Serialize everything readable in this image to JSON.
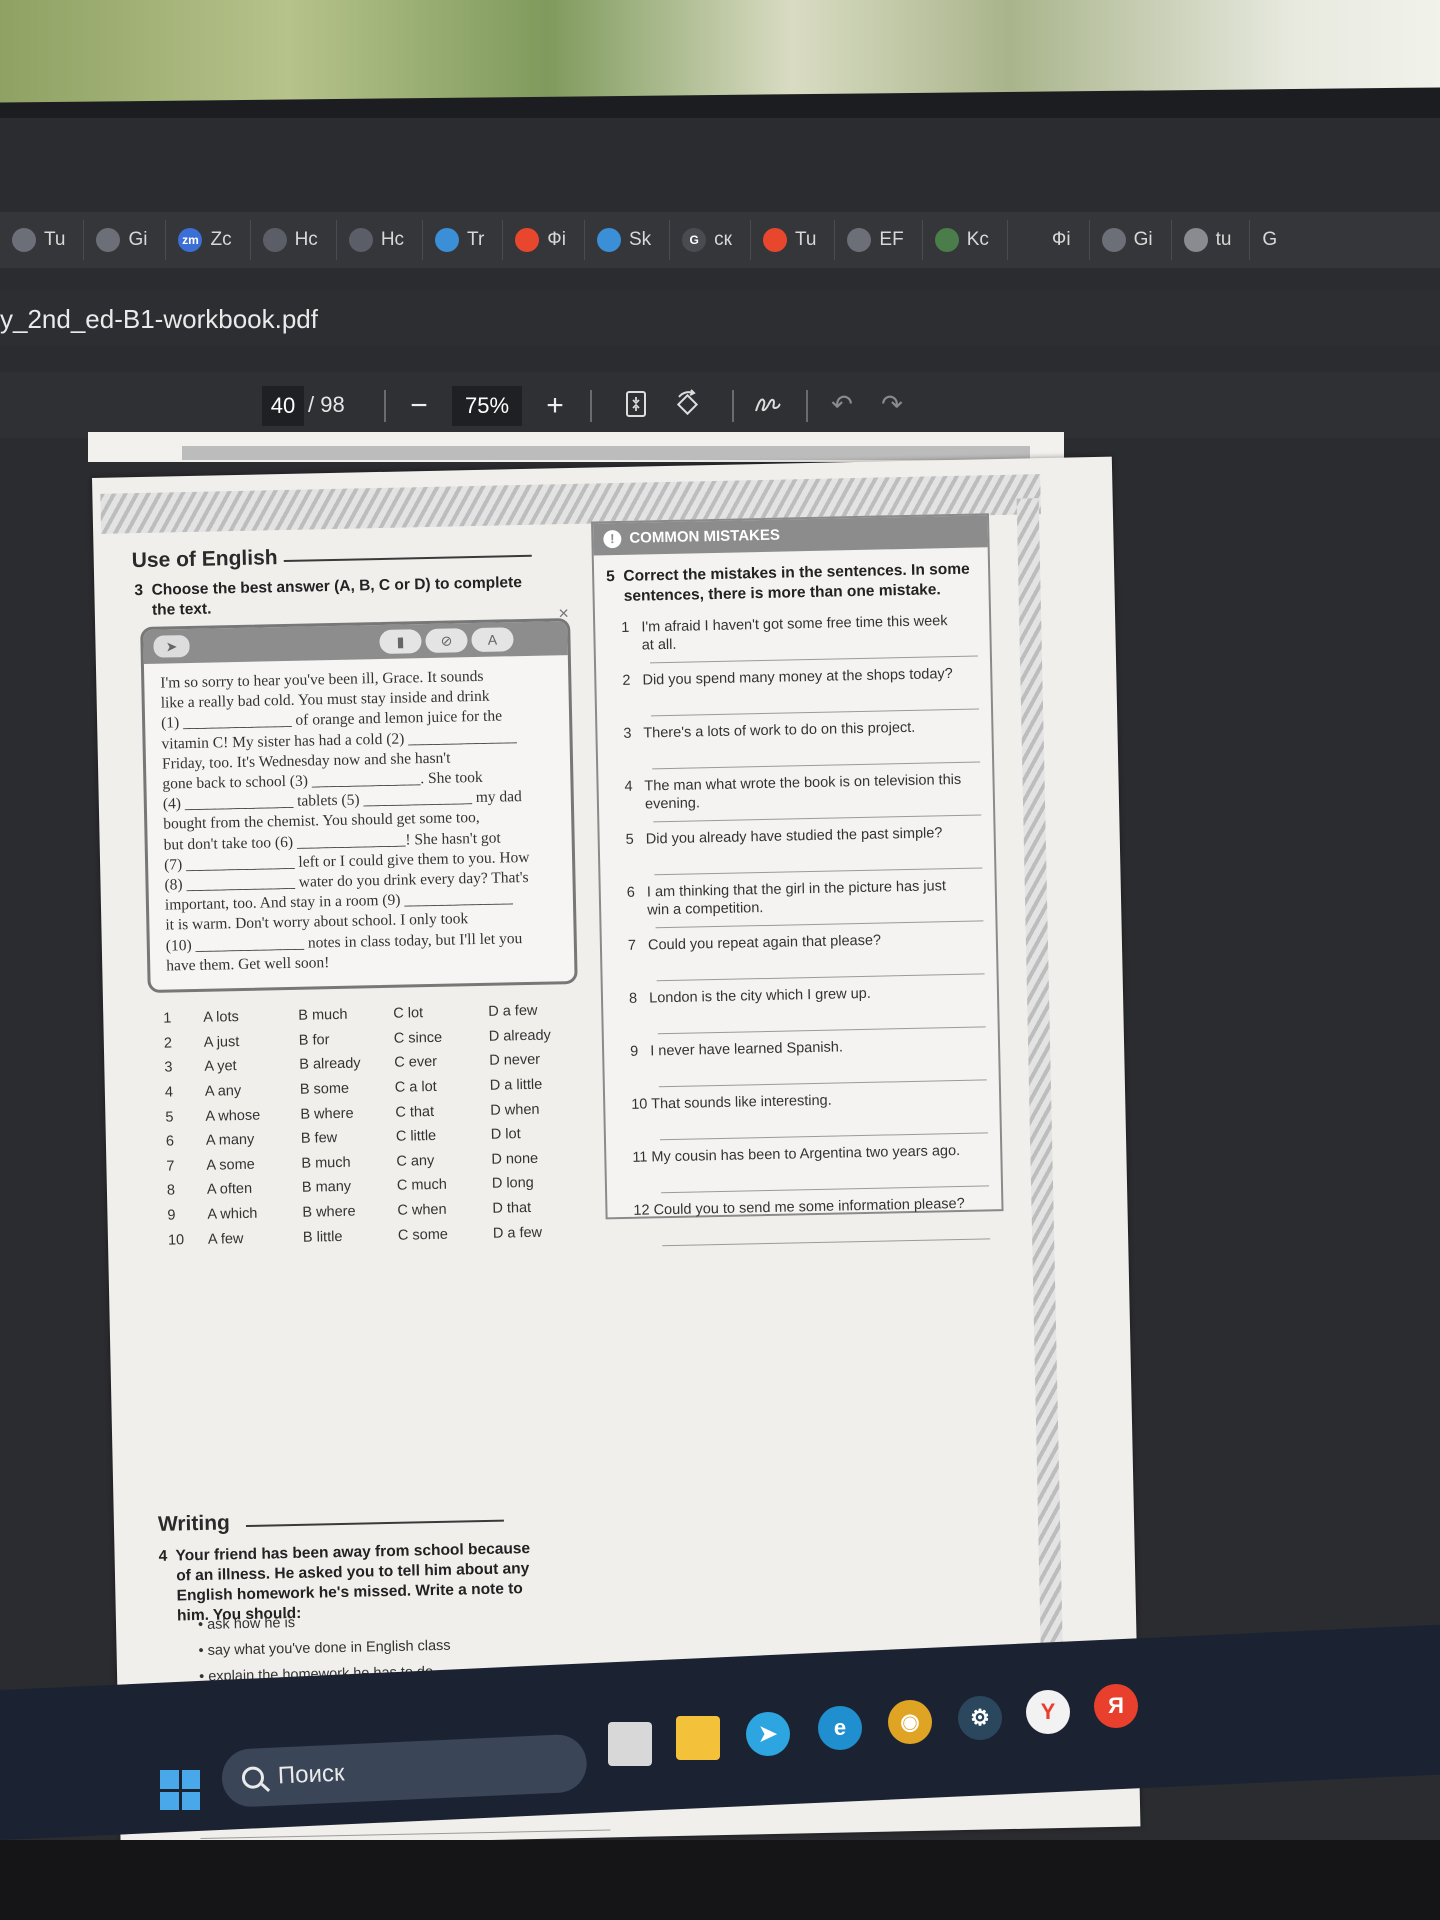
{
  "bookmarks": [
    {
      "label": "Tu",
      "icon": "steam-icon",
      "color": "#6c6f78"
    },
    {
      "label": "Gi",
      "icon": "steam-icon",
      "color": "#6c6f78"
    },
    {
      "label": "Zc",
      "icon": "zm-icon",
      "color": "#3b6fd6"
    },
    {
      "label": "Hc",
      "icon": "shield-icon",
      "color": "#5b5e66"
    },
    {
      "label": "Hc",
      "icon": "shield-icon",
      "color": "#5b5e66"
    },
    {
      "label": "Tr",
      "icon": "cube-icon",
      "color": "#3b8fd6"
    },
    {
      "label": "Фi",
      "icon": "reddit-icon",
      "color": "#e8472d"
    },
    {
      "label": "Sk",
      "icon": "cube-icon",
      "color": "#3b8fd6"
    },
    {
      "label": "ск",
      "icon": "google-icon",
      "color": "#4a4b50"
    },
    {
      "label": "Tu",
      "icon": "flower-icon",
      "color": "#e8472d"
    },
    {
      "label": "EF",
      "icon": "steam-icon",
      "color": "#6c6f78"
    },
    {
      "label": "Kc",
      "icon": "globe-icon",
      "color": "#4b7d4a"
    },
    {
      "label": "Фi",
      "icon": "",
      "color": "#35363a"
    },
    {
      "label": "Gi",
      "icon": "steam-icon",
      "color": "#6c6f78"
    },
    {
      "label": "tu",
      "icon": "app-icon",
      "color": "#8a8b90"
    }
  ],
  "bookmark_overflow": "G",
  "doc_title": "y_2nd_ed-B1-workbook.pdf",
  "toolbar": {
    "page_current": "40",
    "page_total": "/ 98",
    "zoom_out": "−",
    "zoom_level": "75%",
    "zoom_in": "+"
  },
  "page": {
    "use_of_english": "Use of English",
    "task3": "3  Choose the best answer (A, B, C or D) to complete\n    the text.",
    "email_lines": [
      "I'm so sorry to hear you've been ill, Grace. It sounds",
      "like a really bad cold. You must stay inside and drink",
      "(1) ______________ of orange and lemon juice for the",
      "vitamin C! My sister has had a cold (2) ______________",
      "Friday, too. It's Wednesday now and she hasn't",
      "gone back to school (3) ______________. She took",
      "(4) ______________ tablets (5) ______________ my dad",
      "bought from the chemist. You should get some too,",
      "but don't take too (6) ______________! She hasn't got",
      "(7) ______________ left or I could give them to you. How",
      "(8) ______________ water do you drink every day? That's",
      "important, too. And stay in a room (9) ______________",
      "it is warm. Don't worry about school. I only took",
      "(10) ______________ notes in class today, but I'll let you",
      "have them. Get well soon!"
    ],
    "options": [
      [
        "1",
        "A  lots",
        "B  much",
        "C  lot",
        "D  a few"
      ],
      [
        "2",
        "A  just",
        "B  for",
        "C  since",
        "D  already"
      ],
      [
        "3",
        "A  yet",
        "B  already",
        "C  ever",
        "D  never"
      ],
      [
        "4",
        "A  any",
        "B  some",
        "C  a lot",
        "D  a little"
      ],
      [
        "5",
        "A  whose",
        "B  where",
        "C  that",
        "D  when"
      ],
      [
        "6",
        "A  many",
        "B  few",
        "C  little",
        "D  lot"
      ],
      [
        "7",
        "A  some",
        "B  much",
        "C  any",
        "D  none"
      ],
      [
        "8",
        "A  often",
        "B  many",
        "C  much",
        "D  long"
      ],
      [
        "9",
        "A  which",
        "B  where",
        "C  when",
        "D  that"
      ],
      [
        "10",
        "A  few",
        "B  little",
        "C  some",
        "D  a few"
      ]
    ],
    "writing": "Writing",
    "task4": "4  Your friend has been away from school because\n    of an illness. He asked you to tell him about any\n    English homework he's missed. Write a note to\n    him. You should:",
    "bullets": [
      "ask how he is",
      "say what you've done in English class",
      "explain the homework he has to do"
    ],
    "common_mistakes": "COMMON MISTAKES",
    "task5": "5  Correct the mistakes in the sentences. In some\n    sentences, there is more than one mistake.",
    "sentences": [
      "1   I'm afraid I haven't got some free time this week\n     at all.",
      "2   Did you spend many money at the shops today?",
      "3   There's a lots of work to do on this project.",
      "4   The man what wrote the book is on television this\n     evening.",
      "5   Did you already have studied the past simple?",
      "6   I am thinking that the girl in the picture has just\n     win a competition.",
      "7   Could you repeat again that please?",
      "8   London is the city which I grew up.",
      "9   I never have learned Spanish.",
      "10 That sounds like interesting.",
      "11 My cousin has been to Argentina two years ago.",
      "12 Could you to send me some information please?"
    ]
  },
  "taskbar": {
    "search_placeholder": "Поиск",
    "apps": [
      {
        "name": "file-manager-icon",
        "color": "#d8d8d8",
        "glyph": ""
      },
      {
        "name": "folder-icon",
        "color": "#f3c13a",
        "glyph": ""
      },
      {
        "name": "telegram-icon",
        "color": "#2ca5e0",
        "glyph": "➤"
      },
      {
        "name": "edge-icon",
        "color": "#1f8fd0",
        "glyph": "e"
      },
      {
        "name": "chrome-icon",
        "color": "#e0a425",
        "glyph": "◉"
      },
      {
        "name": "steam-icon",
        "color": "#2a475e",
        "glyph": "⚙"
      },
      {
        "name": "yandex-browser-icon",
        "color": "#f2f2f2",
        "glyph": "Y"
      },
      {
        "name": "yandex-icon",
        "color": "#e8402d",
        "glyph": "Я"
      }
    ]
  }
}
